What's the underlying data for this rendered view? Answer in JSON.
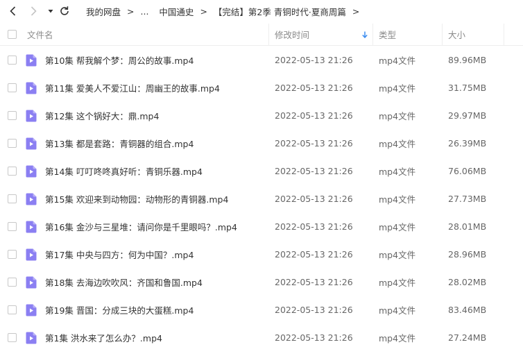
{
  "nav": {
    "breadcrumb": [
      "我的网盘",
      "...",
      "中国通史",
      "【完结】第2季 青铜时代·夏商周篇"
    ],
    "separator": ">"
  },
  "header": {
    "name": "文件名",
    "modified": "修改时间",
    "type": "类型",
    "size": "大小"
  },
  "files": [
    {
      "name": "第10集 帮我解个梦：周公的故事.mp4",
      "modified": "2022-05-13 21:26",
      "type": "mp4文件",
      "size": "89.96MB"
    },
    {
      "name": "第11集 爱美人不爱江山：周幽王的故事.mp4",
      "modified": "2022-05-13 21:26",
      "type": "mp4文件",
      "size": "31.75MB"
    },
    {
      "name": "第12集 这个锅好大：鼎.mp4",
      "modified": "2022-05-13 21:26",
      "type": "mp4文件",
      "size": "29.97MB"
    },
    {
      "name": "第13集 都是套路：青铜器的组合.mp4",
      "modified": "2022-05-13 21:26",
      "type": "mp4文件",
      "size": "26.39MB"
    },
    {
      "name": "第14集 叮叮咚咚真好听：青铜乐器.mp4",
      "modified": "2022-05-13 21:26",
      "type": "mp4文件",
      "size": "76.06MB"
    },
    {
      "name": "第15集 欢迎来到动物园：动物形的青铜器.mp4",
      "modified": "2022-05-13 21:26",
      "type": "mp4文件",
      "size": "27.73MB"
    },
    {
      "name": "第16集 金沙与三星堆：请问你是千里眼吗？.mp4",
      "modified": "2022-05-13 21:26",
      "type": "mp4文件",
      "size": "28.01MB"
    },
    {
      "name": "第17集 中央与四方：何为中国？.mp4",
      "modified": "2022-05-13 21:26",
      "type": "mp4文件",
      "size": "28.96MB"
    },
    {
      "name": "第18集 去海边吹吹风：齐国和鲁国.mp4",
      "modified": "2022-05-13 21:26",
      "type": "mp4文件",
      "size": "28.02MB"
    },
    {
      "name": "第19集 晋国：分成三块的大蛋糕.mp4",
      "modified": "2022-05-13 21:26",
      "type": "mp4文件",
      "size": "83.46MB"
    },
    {
      "name": "第1集 洪水来了怎么办？.mp4",
      "modified": "2022-05-13 21:26",
      "type": "mp4文件",
      "size": "27.24MB"
    }
  ],
  "colors": {
    "accent": "#3b8cf0",
    "video_icon": "#8b7ff2",
    "text": "#333333",
    "muted": "#8a8a8a"
  },
  "icons": {
    "back": "chevron-left-icon",
    "forward": "chevron-right-icon",
    "history": "caret-down-icon",
    "refresh": "refresh-icon",
    "sort": "sort-down-arrow-icon",
    "file": "video-file-icon"
  }
}
